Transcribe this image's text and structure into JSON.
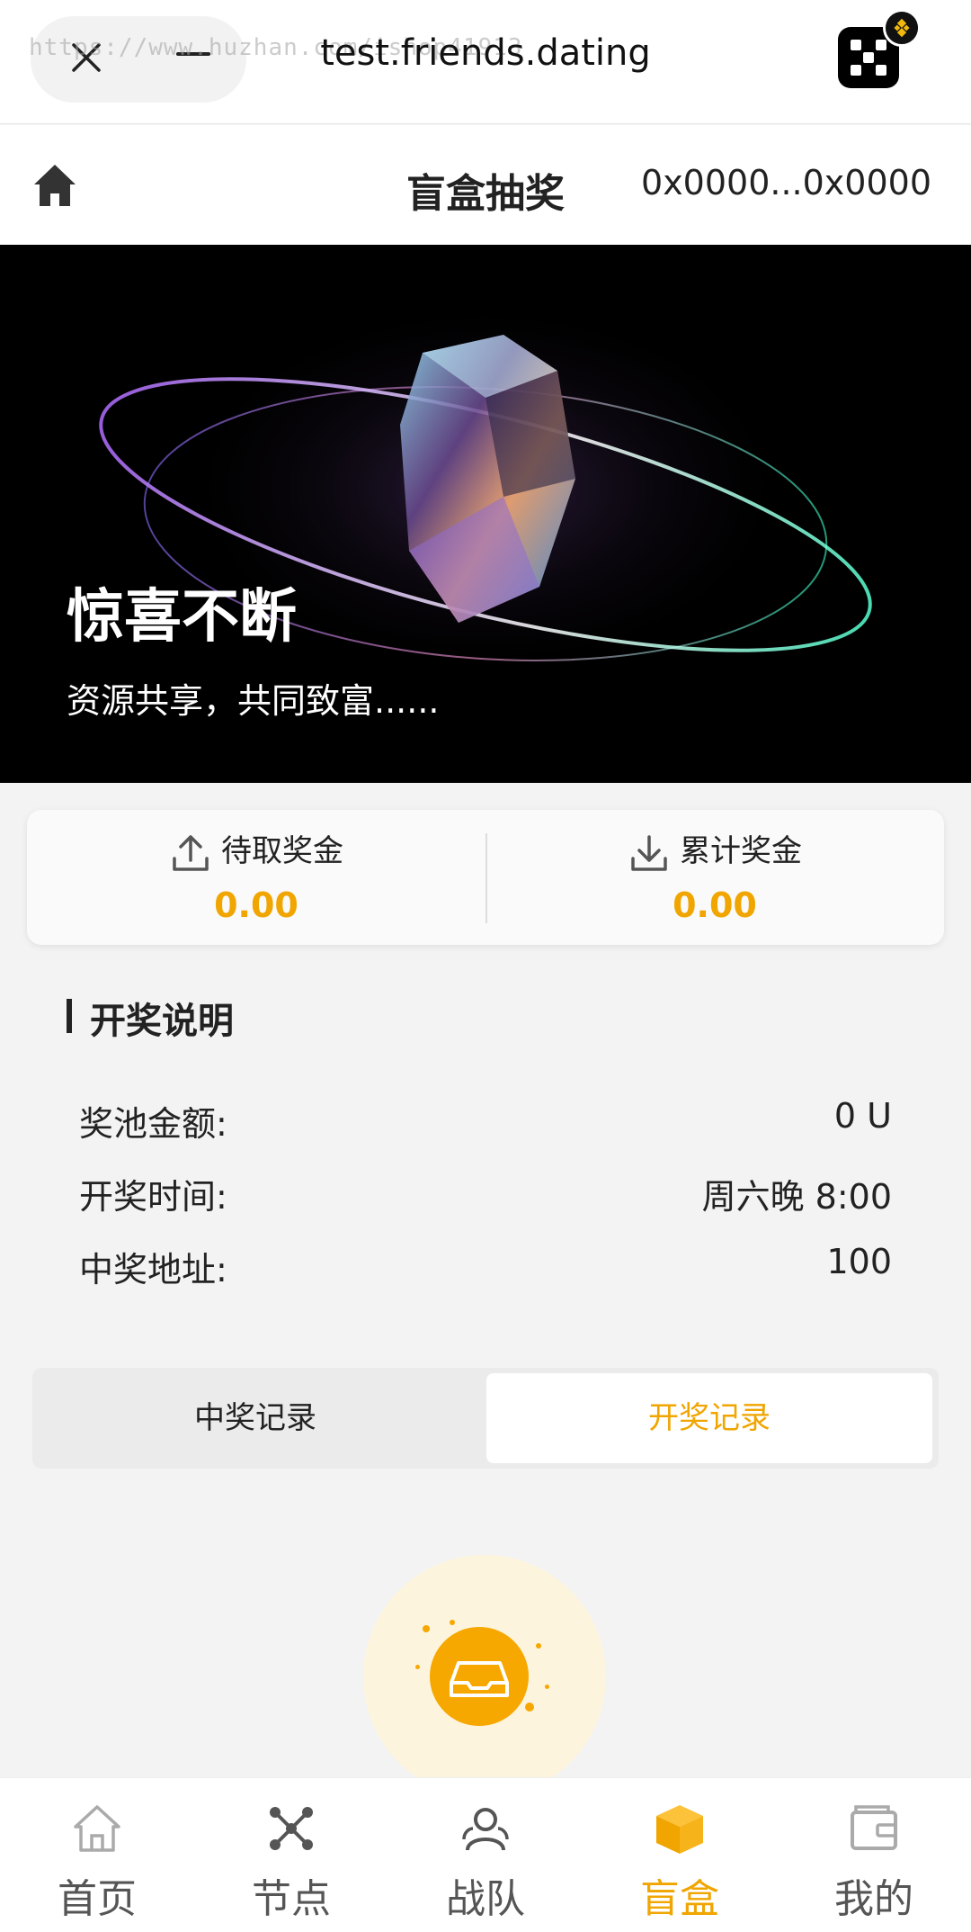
{
  "browser": {
    "watermark": "https://www.huzhan.com/ishop41913",
    "domain": "test.friends.dating"
  },
  "header": {
    "title": "盲盒抽奖",
    "wallet": "0x0000...0x0000"
  },
  "banner": {
    "title": "惊喜不断",
    "subtitle": "资源共享，共同致富......"
  },
  "prizes": {
    "pending_label": "待取奖金",
    "pending_value": "0.00",
    "total_label": "累计奖金",
    "total_value": "0.00"
  },
  "rules": {
    "heading": "开奖说明",
    "rows": [
      {
        "label": "奖池金额:",
        "value": "0 U"
      },
      {
        "label": "开奖时间:",
        "value": "周六晚 8:00"
      },
      {
        "label": "中奖地址:",
        "value": "100"
      }
    ]
  },
  "tabs": {
    "winners": "中奖记录",
    "draws": "开奖记录",
    "active": "draws"
  },
  "nav": {
    "items": [
      {
        "label": "首页",
        "icon": "home-icon"
      },
      {
        "label": "节点",
        "icon": "node-icon"
      },
      {
        "label": "战队",
        "icon": "team-icon"
      },
      {
        "label": "盲盒",
        "icon": "box-icon"
      },
      {
        "label": "我的",
        "icon": "wallet-icon"
      }
    ],
    "active_index": 3
  },
  "colors": {
    "accent": "#f0a500",
    "inactive_nav": "#555555"
  }
}
